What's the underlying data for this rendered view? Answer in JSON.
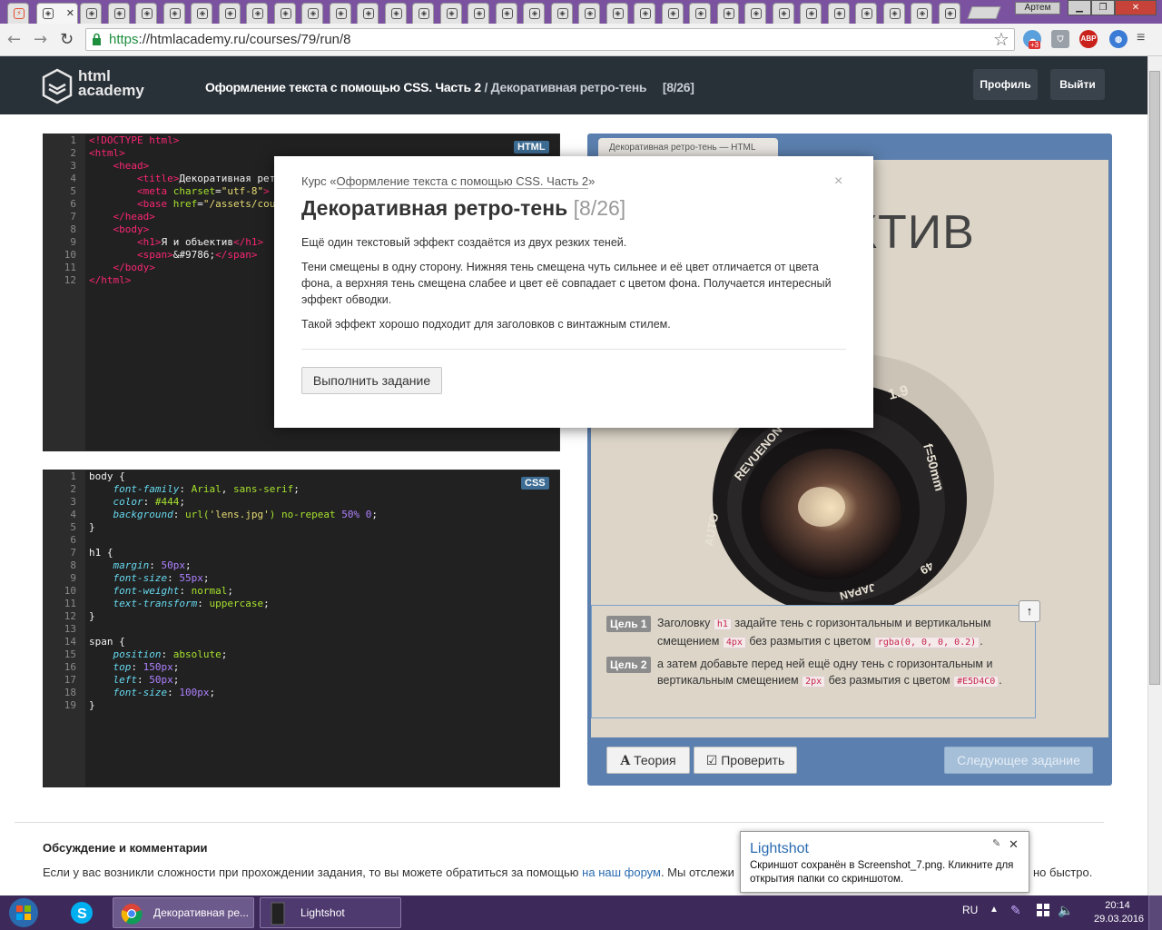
{
  "browser": {
    "user_name": "Артем",
    "url_scheme": "https",
    "url_rest": "://htmlacademy.ru/courses/79/run/8",
    "ext_badge": "+3",
    "abp_label": "ABP"
  },
  "header": {
    "logo_line1": "html",
    "logo_line2": "academy",
    "course_part": "Оформление текста с помощью CSS. Часть 2",
    "separator": "/",
    "lesson": "Декоративная ретро-тень",
    "counter": "[8/26]",
    "profile_button": "Профиль",
    "logout_button": "Выйти"
  },
  "html_editor": {
    "badge": "HTML",
    "line_numbers": [
      "1",
      "2",
      "3",
      "4",
      "5",
      "6",
      "7",
      "8",
      "9",
      "10",
      "11",
      "12"
    ]
  },
  "css_editor": {
    "badge": "CSS",
    "line_numbers": [
      "1",
      "2",
      "3",
      "4",
      "5",
      "6",
      "7",
      "8",
      "9",
      "10",
      "11",
      "12",
      "13",
      "14",
      "15",
      "16",
      "17",
      "18",
      "19"
    ]
  },
  "preview": {
    "tab_label": "Декоративная ретро-тень — HTML",
    "heading_visible": "ЕКТИВ",
    "lens_text_1": "REVUENON",
    "lens_text_2": "AUTO",
    "lens_text_3": "f=50mm",
    "lens_text_4": "JAPAN",
    "lens_text_5": "1.9",
    "lens_text_6": "49"
  },
  "goals": [
    {
      "badge": "Цель 1",
      "t1": "Заголовку",
      "c1": "h1",
      "t2": "задайте тень с горизонтальным и вертикальным смещением",
      "c2": "4px",
      "t3": "без размытия с цветом",
      "c3": "rgba(0, 0, 0, 0.2)",
      "t4": "."
    },
    {
      "badge": "Цель 2",
      "t1": "а затем добавьте перед ней ещё одну тень с горизонтальным и вертикальным смещением",
      "c1": "2px",
      "t2": "без размытия с цветом",
      "c2": "#E5D4C0",
      "t3": "."
    }
  ],
  "preview_buttons": {
    "theory": "Теория",
    "check": "Проверить",
    "next": "Следующее задание"
  },
  "modal": {
    "course_prefix": "Курс «",
    "course_link": "Оформление текста с помощью CSS. Часть 2",
    "course_suffix": "»",
    "title": "Декоративная ретро-тень",
    "counter": "[8/26]",
    "p1": "Ещё один текстовый эффект создаётся из двух резких теней.",
    "p2": "Тени смещены в одну сторону. Нижняя тень смещена чуть сильнее и её цвет отличается от цвета фона, а верхняя тень смещена слабее и цвет её совпадает с цветом фона. Получается интересный эффект обводки.",
    "p3": "Такой эффект хорошо подходит для заголовков с винтажным стилем.",
    "button": "Выполнить задание",
    "close": "×"
  },
  "discussion": {
    "title": "Обсуждение и комментарии",
    "text_before": "Если у вас возникли сложности при прохождении задания, то вы можете обратиться за помощью",
    "link": "на наш форум",
    "text_after": ". Мы отслежи",
    "tail": "но быстро."
  },
  "lightshot": {
    "title": "Lightshot",
    "text": "Скриншот сохранён в Screenshot_7.png. Кликните для открытия папки со скриншотом."
  },
  "taskbar": {
    "chrome_task": "Декоративная ре...",
    "lightshot_task": "Lightshot",
    "lang": "RU",
    "time": "20:14",
    "date": "29.03.2016"
  }
}
